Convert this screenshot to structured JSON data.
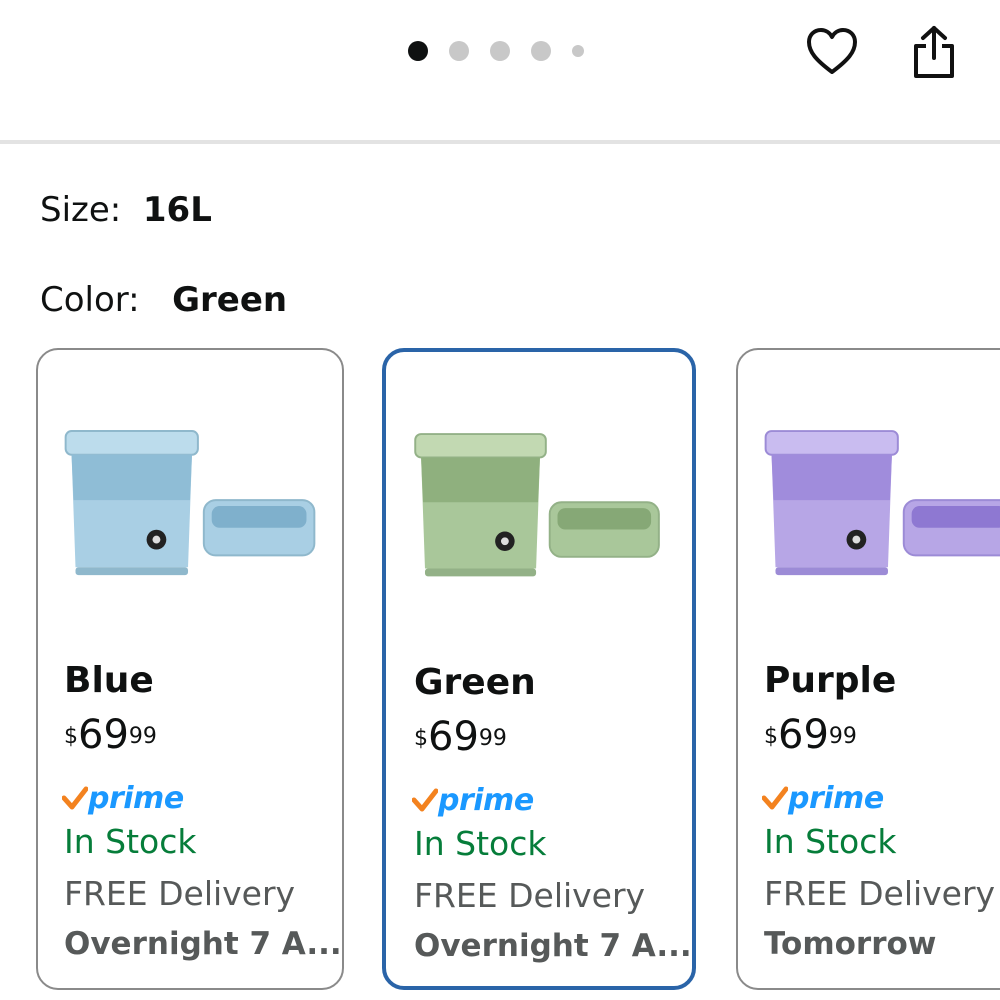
{
  "header": {
    "carousel": {
      "total": 5,
      "active_index": 0
    },
    "icons": [
      "heart-icon",
      "share-icon"
    ]
  },
  "selection": {
    "size_label": "Size:",
    "size_value": "16L",
    "color_label": "Color:",
    "color_value": "Green"
  },
  "variants": [
    {
      "name": "Blue",
      "price_symbol": "$",
      "price_whole": "69",
      "price_cents": "99",
      "prime": "prime",
      "stock": "In Stock",
      "delivery": "FREE Delivery",
      "delivery_date": "Overnight 7 A...",
      "selected": false,
      "color": "#a9cfe4"
    },
    {
      "name": "Green",
      "price_symbol": "$",
      "price_whole": "69",
      "price_cents": "99",
      "prime": "prime",
      "stock": "In Stock",
      "delivery": "FREE Delivery",
      "delivery_date": "Overnight 7 A...",
      "selected": true,
      "color": "#a9c79a"
    },
    {
      "name": "Purple",
      "price_symbol": "$",
      "price_whole": "69",
      "price_cents": "99",
      "prime": "prime",
      "stock": "In Stock",
      "delivery": "FREE Delivery",
      "delivery_date": "Tomorrow",
      "selected": false,
      "color": "#b7a6e6"
    }
  ],
  "colors": {
    "selected_border": "#2a64a8",
    "stock_green": "#067d3a",
    "prime_blue": "#1a98ff",
    "prime_check": "#f3821f"
  }
}
